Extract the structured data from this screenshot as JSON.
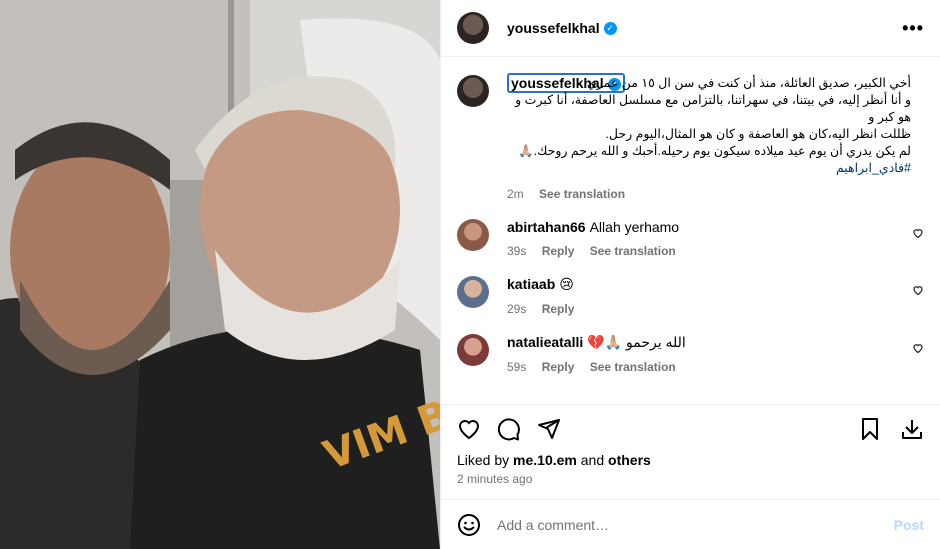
{
  "header": {
    "username": "youssefelkhal",
    "verified": true,
    "more_label": "•••"
  },
  "caption": {
    "username": "youssefelkhal",
    "lines": [
      "أخي الكبير، صديق العائلة، منذ أن كنت في سن ال ١٥ من عمري",
      "و أنا أنظر إليه، في بيتنا، في سهراتنا، بالتزامن مع مسلسل العاصفة، أنا كبرت و هو كبر و",
      "ظللت انظر اليه،كان هو العاصفة و كان هو المثال،اليوم رحل.",
      "لم يكن يدري أن يوم عيد ميلاده سيكون يوم رحيله.أحبك و الله يرحم روحك.🙏🏼",
      "#فادي_ابراهيم"
    ],
    "time": "2m",
    "see_translation": "See translation"
  },
  "comments": [
    {
      "user": "abirtahan66",
      "text": "Allah yerhamo",
      "time": "39s",
      "reply": "Reply",
      "see_translation": "See translation",
      "avatar_color": "#8a5a48"
    },
    {
      "user": "katiaab",
      "text": "😢",
      "time": "29s",
      "reply": "Reply",
      "see_translation": "",
      "avatar_color": "#5c6f8c"
    },
    {
      "user": "natalieatalli",
      "text": "💔🙏🏼 الله يرحمو",
      "time": "59s",
      "reply": "Reply",
      "see_translation": "See translation",
      "avatar_color": "#7a3b3a"
    }
  ],
  "likes": {
    "prefix": "Liked by",
    "user": "me.10.em",
    "joiner": "and",
    "others": "others"
  },
  "posted_ago": "2 minutes ago",
  "add_comment": {
    "placeholder": "Add a comment…",
    "post_label": "Post"
  },
  "icons": [
    "more-icon",
    "heart-icon",
    "comment-icon",
    "share-icon",
    "bookmark-icon",
    "download-icon",
    "emoji-icon"
  ],
  "colors": {
    "verified": "#0095f6",
    "meta": "#737373",
    "post_disabled": "#b3dbff",
    "hashtag": "#00376b"
  }
}
